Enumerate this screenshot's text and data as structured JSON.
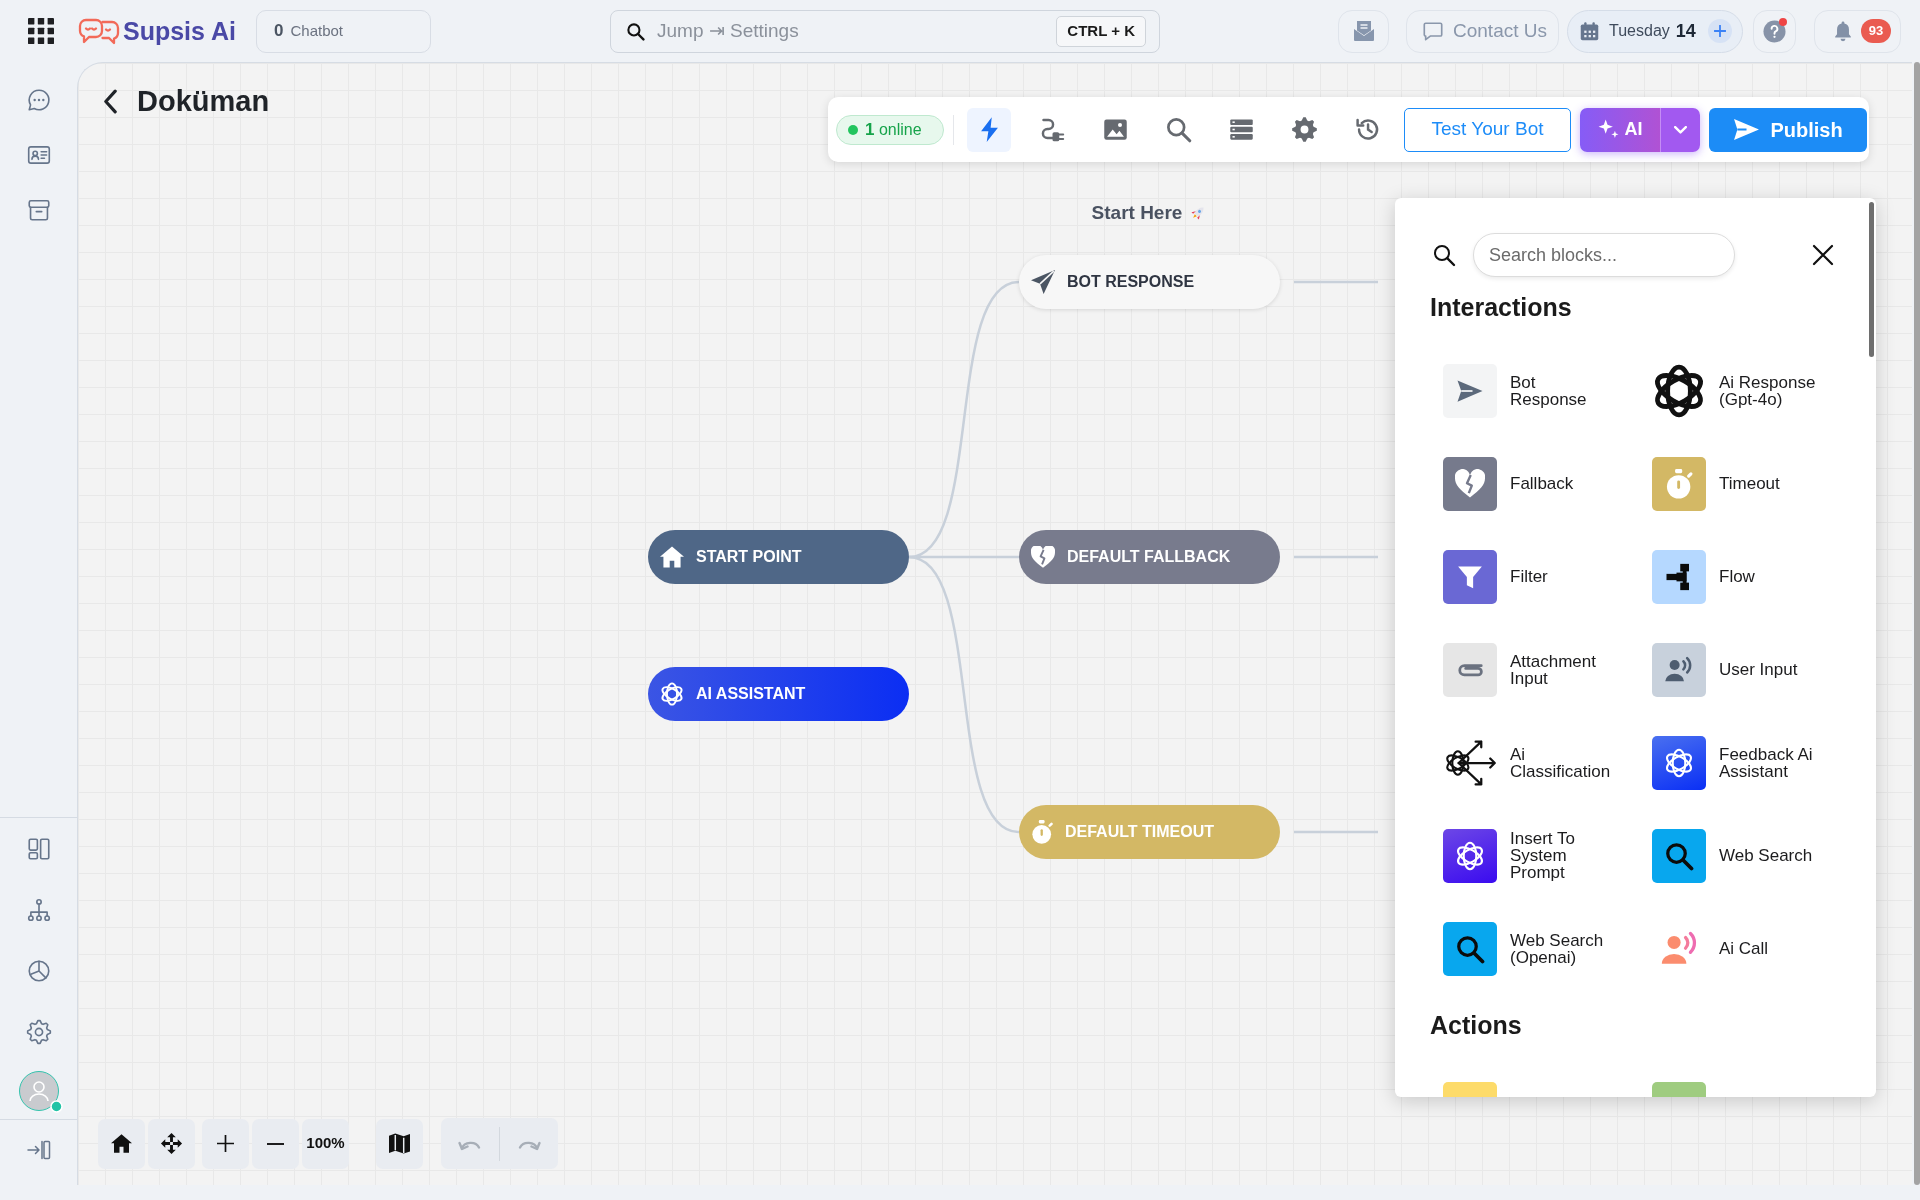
{
  "top_bar": {
    "logo": "Supsis Ai",
    "chatbot_counter": {
      "count": "0",
      "label": "Chatbot"
    },
    "search": {
      "placeholder": "Jump ⇥ Settings",
      "shortcut": "CTRL + K"
    },
    "contact_button": "Contact Us",
    "date": {
      "weekday": "Tuesday",
      "day": "14"
    },
    "help": {
      "unread": true
    },
    "notifications": {
      "count": "93"
    }
  },
  "sidebar": {
    "top_items": [
      {
        "selected": false
      },
      {
        "selected": false
      },
      {
        "selected": false
      }
    ],
    "bottom_items": [
      {
        "selected": false
      },
      {
        "selected": false
      },
      {
        "selected": false
      },
      {
        "selected": false
      }
    ],
    "user": {
      "online": true
    }
  },
  "page": {
    "title": "Doküman"
  },
  "toolbar": {
    "status": "**1** online",
    "tools": [
      {
        "selected": true
      },
      {
        "selected": false
      },
      {
        "selected": false
      },
      {
        "selected": false
      },
      {
        "selected": false
      },
      {
        "selected": false
      },
      {
        "selected": false
      }
    ],
    "test_button": "Test Your Bot",
    "ai_button": "AI",
    "publish_button": "Publish"
  },
  "canvas": {
    "start_label": "Start Here",
    "nodes": [
      {
        "label": "START POINT",
        "kind": "start",
        "children": [
          {
            "label": "BOT RESPONSE",
            "kind": "response"
          },
          {
            "label": "DEFAULT FALLBACK",
            "kind": "fallback"
          },
          {
            "label": "DEFAULT TIMEOUT",
            "kind": "timeout"
          }
        ]
      },
      {
        "label": "AI ASSISTANT",
        "kind": "assistant"
      }
    ]
  },
  "blocks_panel": {
    "search": {
      "placeholder": "Search blocks..."
    },
    "sections": [
      {
        "title": "Interactions",
        "blocks": [
          {
            "label": "Bot\nResponse",
            "kind": "response",
            "color": "#f3f4f5"
          },
          {
            "label": "Ai Response\n(Gpt-4o)",
            "kind": "gpt"
          },
          {
            "label": "Fallback",
            "kind": "fallback",
            "color": "#767a8c"
          },
          {
            "label": "Timeout",
            "kind": "timeout",
            "color": "#d3b865"
          },
          {
            "label": "Filter",
            "kind": "filter",
            "color": "#6a68d4"
          },
          {
            "label": "Flow",
            "kind": "flow",
            "color": "#b5d8ff"
          },
          {
            "label": "Attachment\nInput",
            "kind": "attachment",
            "color": "#e6e6e6"
          },
          {
            "label": "User Input",
            "kind": "userinput",
            "color": "#c8d1dc"
          },
          {
            "label": "Ai\nClassification",
            "kind": "classification"
          },
          {
            "label": "Feedback Ai\nAssistant",
            "kind": "feedback"
          },
          {
            "label": "Insert To\nSystem\nPrompt",
            "kind": "prompt"
          },
          {
            "label": "Web Search",
            "kind": "websearch",
            "color": "#08a7ee"
          },
          {
            "label": "Web Search\n(Openai)",
            "kind": "websearch",
            "color": "#08a7ee"
          },
          {
            "label": "Ai Call",
            "kind": "call"
          }
        ]
      },
      {
        "title": "Actions",
        "blocks": [
          {
            "kind": "action",
            "color": "#fddb6a"
          },
          {
            "kind": "action",
            "color": "#9fcc80"
          }
        ]
      }
    ]
  },
  "zoom_controls": {
    "zoom": "100%"
  },
  "history": {
    "undo": {
      "disabled": true
    },
    "redo": {
      "disabled": true
    }
  }
}
